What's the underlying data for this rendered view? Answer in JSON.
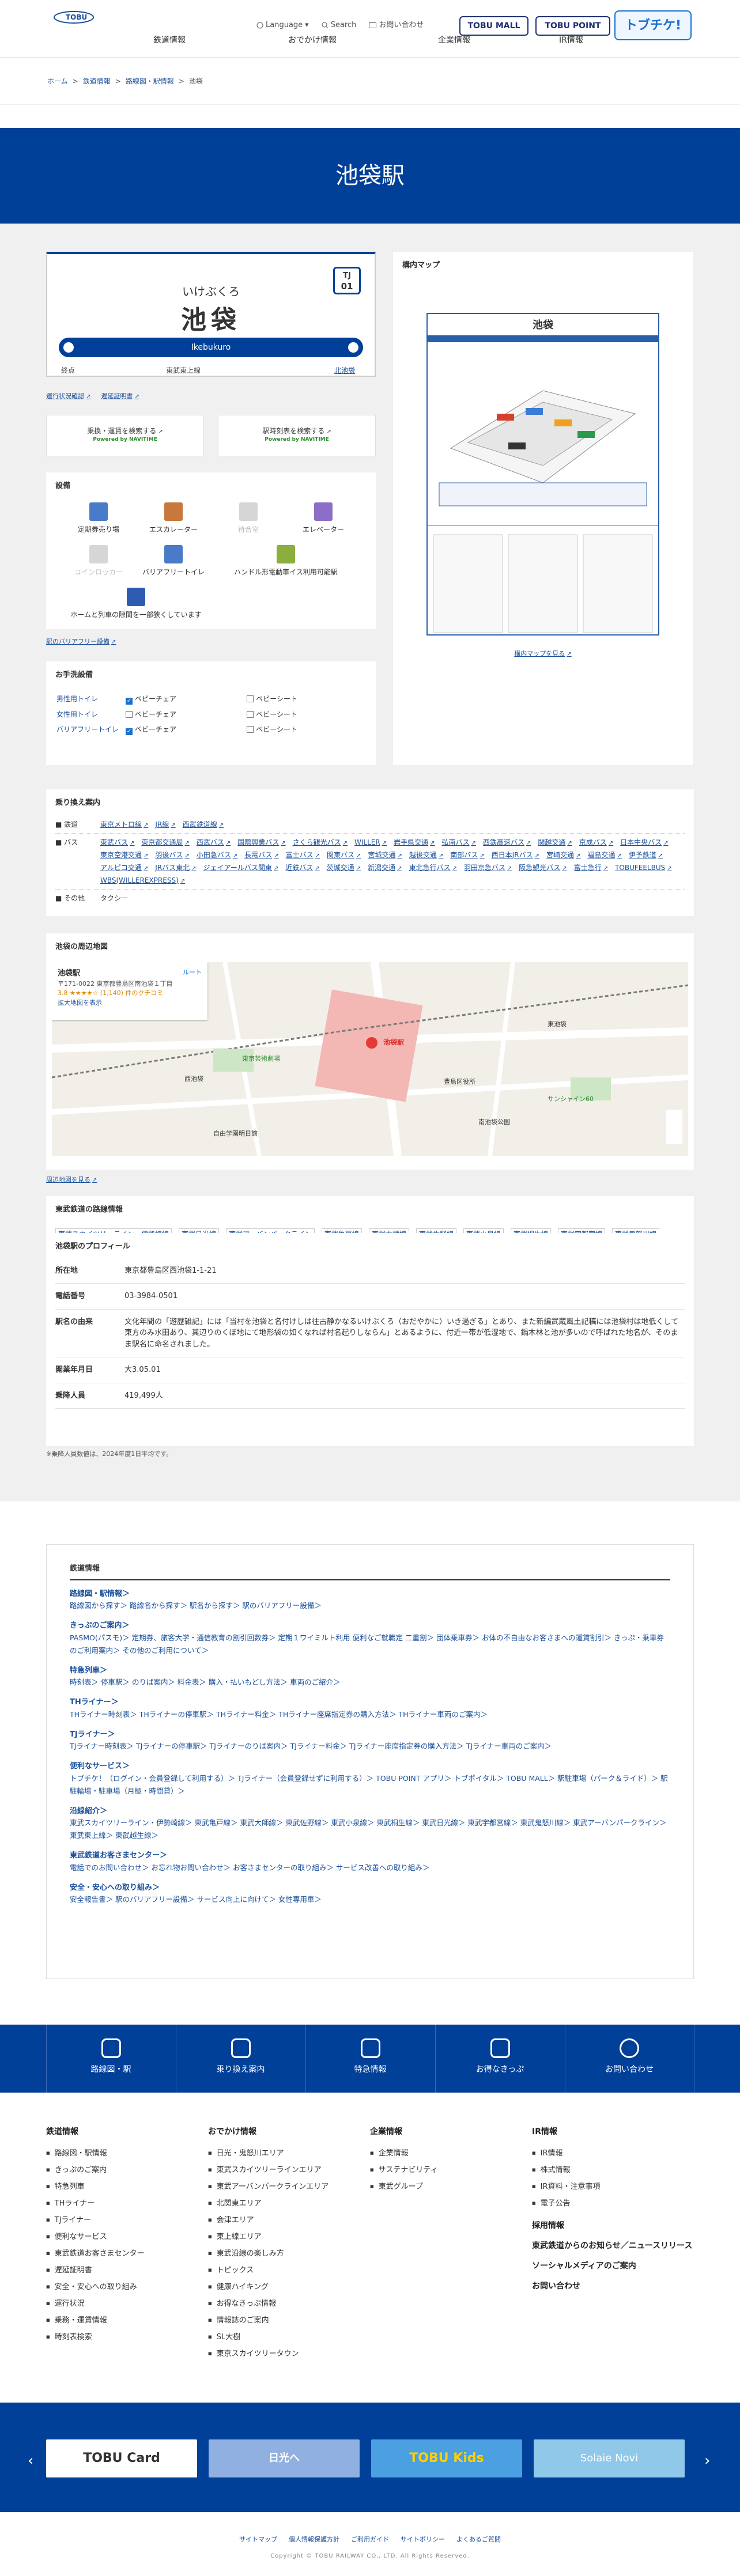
{
  "header": {
    "util": [
      "Language",
      "Search",
      "お問い合わせ"
    ],
    "gnav": [
      "鉄道情報",
      "おでかけ情報",
      "企業情報",
      "IR情報"
    ],
    "buttons": [
      "TOBU MALL",
      "TOBU POINT"
    ],
    "tochike": "トブチケ!"
  },
  "breadcrumb": [
    "ホーム",
    "鉄道情報",
    "路線図・駅情報",
    "池袋"
  ],
  "hero": {
    "title": "池袋駅"
  },
  "station": {
    "kana": "いけぶくろ",
    "kanji": "池袋",
    "code_line": "TJ",
    "code_num": "01",
    "romaji": "Ikebukuro",
    "dir_left": "終点",
    "dir_mid": "東武東上線",
    "dir_right": "北池袋"
  },
  "links_under_sign": [
    "運行状況確認",
    "遅延証明書"
  ],
  "search": {
    "left": "乗換・運賃を検索する",
    "right": "駅時刻表を検索する",
    "powered": "Powered by NAVITIME"
  },
  "facilities": {
    "title": "設備",
    "items": [
      "定期券売り場",
      "エスカレーター",
      "待合室",
      "エレベーター",
      "コインロッカー",
      "バリアフリートイレ",
      "ハンドル形電動車イス利用可能駅",
      "ホームと列車の隙間を一部狭くしています"
    ],
    "link": "駅のバリアフリー設備"
  },
  "barrier": {
    "title": "お手洗設備",
    "rows": [
      {
        "label": "男性用トイレ",
        "a": "ベビーチェア",
        "b": "ベビーシート"
      },
      {
        "label": "女性用トイレ",
        "a": "ベビーチェア",
        "b": "ベビーシート"
      },
      {
        "label": "バリアフリートイレ",
        "a": "ベビーチェア",
        "b": "ベビーシート"
      }
    ]
  },
  "map_panel": {
    "title": "構内マップ",
    "station": "池袋",
    "link": "構内マップを見る"
  },
  "transfer": {
    "title": "乗り換え案内",
    "rail_label": "鉄道",
    "rail": [
      "東京メトロ線",
      "JR線",
      "西武鉄道線"
    ],
    "bus_label": "バス",
    "bus": [
      "東武バス",
      "東京都交通局",
      "西武バス",
      "国際興業バス",
      "さくら観光バス",
      "WILLER",
      "岩手県交通",
      "弘南バス",
      "西鉄高速バス",
      "関越交通",
      "京成バス",
      "日本中央バス",
      "東京空港交通",
      "羽後バス",
      "小田急バス",
      "長電バス",
      "富士バス",
      "関東バス",
      "宮城交通",
      "越後交通",
      "南部バス",
      "西日本JRバス",
      "宮崎交通",
      "福島交通",
      "伊予鉄道",
      "アルピコ交通",
      "JRバス東北",
      "ジェイアールバス関東",
      "近鉄バス",
      "茨城交通",
      "新潟交通",
      "東北急行バス",
      "羽田京急バス",
      "阪急観光バス",
      "富士急行",
      "TOBUFEELBUS",
      "WBS(WILLEREXPRESS)"
    ],
    "other_label": "その他",
    "other": "タクシー"
  },
  "area_map": {
    "title": "池袋の周辺地図",
    "place": "池袋駅",
    "address": "〒171-0022 東京都豊島区南池袋１丁目",
    "rating": "3.8 ★★★★☆ (1,140) 件のクチコミ",
    "bigger": "拡大地図を表示",
    "route": "ルート",
    "link": "周辺地図を見る",
    "labels": [
      "東京芸術劇場",
      "池袋駅",
      "サンシャイン60",
      "西池袋",
      "東池袋",
      "豊島区役所",
      "自由学園明日館",
      "南池袋公園"
    ]
  },
  "lines": {
    "title": "東武鉄道の路線情報",
    "items": [
      "東武スカイツリーライン・伊勢崎線",
      "東武日光線",
      "東武アーバンパークライン",
      "東武亀戸線",
      "東武大師線",
      "東武佐野線",
      "東武小泉線",
      "東武桐生線",
      "東武宇都宮線",
      "東武鬼怒川線",
      "東武東上線",
      "東武越生線"
    ]
  },
  "profile": {
    "title": "池袋駅のプロフィール",
    "rows": [
      [
        "所在地",
        "東京都豊島区西池袋1-1-21"
      ],
      [
        "電話番号",
        "03-3984-0501"
      ],
      [
        "駅名の由来",
        "文化年間の「遊歴雑記」には「当村を池袋と名付けしは往古静かなるいけぶくろ（おだやかに）いき過ぎる」とあり、また新編武蔵風土記稿には池袋村は地低くして東方のみ水田あり、其辺りのくぼ地にて地形袋の如くなれば村名起りしならん」とあるように、付近一帯が低湿地で、鍋木林と池が多いので呼ばれた地名が、そのまま駅名に命名されました。"
      ],
      [
        "開業年月日",
        "大3.05.01"
      ],
      [
        "乗降人員",
        "419,499人"
      ]
    ],
    "note": "※乗降人員数値は、2024年度1日平均です。"
  },
  "sitemap": {
    "heading": "鉄道情報",
    "groups": [
      {
        "h": "路線図・駅情報",
        "p": "路線図から探す＞ 路線名から探す＞ 駅名から探す＞ 駅のバリアフリー設備＞"
      },
      {
        "h": "きっぷのご案内",
        "p": "PASMO(パスモ)＞ 定期券、旅客大学・通信教育の割引回数券＞ 定期１ワイミルト利用 便利なご就職定 二重割＞ 団体乗車券＞ お体の不自由なお客さまへの運賃割引＞ きっぷ・乗車券のご利用案内＞ その他のご利用について＞"
      },
      {
        "h": "特急列車",
        "p": "時刻表＞ 停車駅＞ のりば案内＞ 料金表＞ 購入・払いもどし方法＞ 車両のご紹介＞"
      },
      {
        "h": "THライナー",
        "p": "THライナー時刻表＞ THライナーの停車駅＞ THライナー料金＞ THライナー座席指定券の購入方法＞ THライナー車両のご案内＞"
      },
      {
        "h": "TJライナー",
        "p": "TJライナー時刻表＞ TJライナーの停車駅＞ TJライナーのりば案内＞ TJライナー料金＞ TJライナー座席指定券の購入方法＞ TJライナー車両のご案内＞"
      },
      {
        "h": "便利なサービス",
        "p": "トブチケ！（ログイン・会員登録して利用する）＞ TJライナー（会員登録せずに利用する）＞ TOBU POINT アプリ＞ トブポイタル＞ TOBU MALL＞ 駅駐車場（パーク＆ライド）＞ 駅駐輪場・駐車場（月極・時間貸）＞"
      },
      {
        "h": "沿線紹介",
        "p": "東武スカイツリーライン・伊勢崎線＞ 東武亀戸線＞ 東武大師線＞ 東武佐野線＞ 東武小泉線＞ 東武桐生線＞ 東武日光線＞ 東武宇都宮線＞ 東武鬼怒川線＞ 東武アーバンパークライン＞ 東武東上線＞ 東武越生線＞"
      },
      {
        "h": "東武鉄道お客さまセンター",
        "p": "電話でのお問い合わせ＞ お忘れ物お問い合わせ＞ お客さまセンターの取り組み＞ サービス改善への取り組み＞"
      },
      {
        "h": "安全・安心への取り組み",
        "p": "安全報告書＞ 駅のバリアフリー設備＞ サービス向上に向けて＞ 女性専用車＞"
      }
    ]
  },
  "quicknav": [
    "路線図・駅",
    "乗り換え案内",
    "特急情報",
    "お得なきっぷ",
    "お問い合わせ"
  ],
  "footer_nav": [
    {
      "h": "鉄道情報",
      "items": [
        "路線図・駅情報",
        "きっぷのご案内",
        "特急列車",
        "THライナー",
        "TJライナー",
        "便利なサービス",
        "東武鉄道お客さまセンター",
        "遅延証明書",
        "安全・安心への取り組み",
        "運行状況",
        "乗務・運賃情報",
        "時刻表検索"
      ]
    },
    {
      "h": "おでかけ情報",
      "items": [
        "日光・鬼怒川エリア",
        "東武スカイツリーラインエリア",
        "東武アーバンパークラインエリア",
        "北関東エリア",
        "会津エリア",
        "東上線エリア",
        "東武沿線の楽しみ方",
        "トピックス",
        "健康ハイキング",
        "お得なきっぷ情報",
        "情報誌のご案内",
        "SL大樹",
        "東京スカイツリータウン"
      ]
    },
    {
      "h": "企業情報",
      "items": [
        "企業情報",
        "サステナビリティ",
        "東武グループ"
      ]
    },
    {
      "h": "IR情報",
      "items": [
        "IR情報",
        "株式情報",
        "IR資料・注意事項",
        "電子公告"
      ],
      "extra": [
        "採用情報",
        "東武鉄道からのお知らせ／ニュースリリース",
        "ソーシャルメディアのご案内",
        "お問い合わせ"
      ]
    }
  ],
  "banners": [
    "TOBU Card",
    "日光へ",
    "TOBU Kids",
    "Solaie Novi"
  ],
  "footer": {
    "links": [
      "サイトマップ",
      "個人情報保護方針",
      "ご利用ガイド",
      "サイトポリシー",
      "よくあるご質問"
    ],
    "copy": "Copyright © TOBU RAILWAY CO., LTD. All Rights Reserved."
  }
}
